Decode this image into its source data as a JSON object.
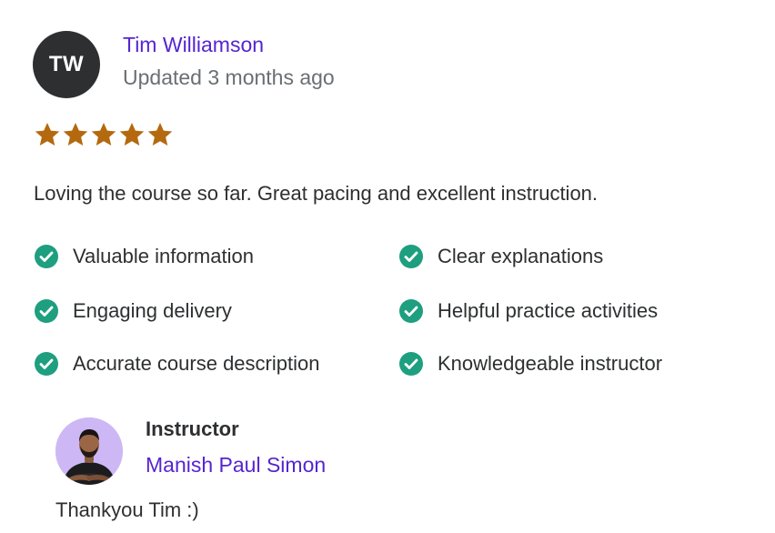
{
  "review": {
    "reviewer_initials": "TW",
    "reviewer_name": "Tim Williamson",
    "updated": "Updated 3 months ago",
    "rating": 5,
    "rating_max": 5,
    "text": "Loving the course so far. Great pacing and excellent instruction.",
    "tags": [
      "Valuable information",
      "Clear explanations",
      "Engaging delivery",
      "Helpful practice activities",
      "Accurate course description",
      "Knowledgeable instructor"
    ],
    "colors": {
      "link": "#5624d0",
      "star": "#b4690e",
      "check": "#1e9f7f",
      "avatar_bg": "#2d2f31",
      "muted_text": "#6a6f73"
    }
  },
  "response": {
    "role": "Instructor",
    "name": "Manish Paul Simon",
    "text": "Thankyou Tim :)"
  },
  "icons": {
    "star": "star-icon",
    "check": "check-circle-icon"
  }
}
